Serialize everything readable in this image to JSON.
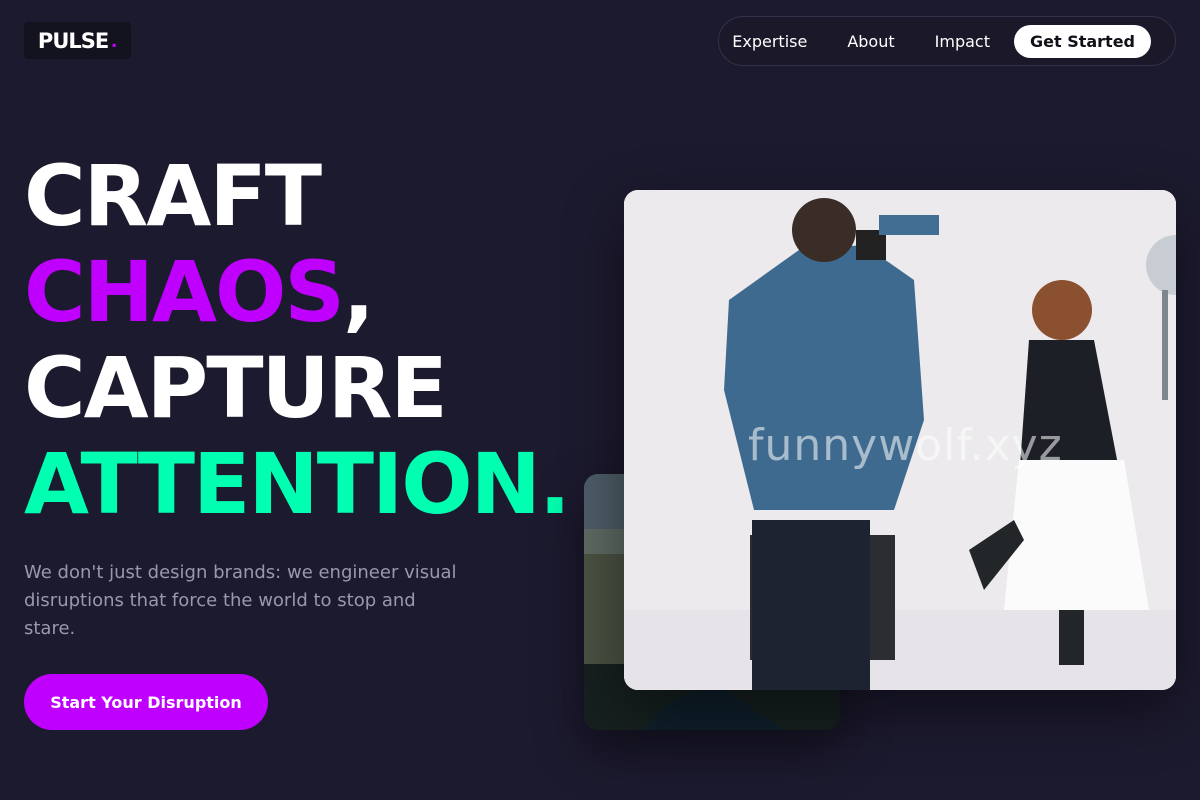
{
  "logo": {
    "text": "PULSE",
    "dot": "."
  },
  "nav": {
    "links": [
      "Expertise",
      "About",
      "Impact"
    ],
    "cta": "Get Started"
  },
  "hero": {
    "line1": "CRAFT",
    "line2_highlight": "CHAOS",
    "line2_suffix": ",",
    "line3": "CAPTURE",
    "line4": "ATTENTION.",
    "subtext": "We don't just design brands: we engineer visual disruptions that force the world to stop and stare.",
    "cta": "Start Your Disruption"
  },
  "images": {
    "watermark": "funnywolf.xyz"
  },
  "colors": {
    "background": "#1c1a2e",
    "accent_purple": "#c000ff",
    "accent_green": "#00ffb0"
  }
}
